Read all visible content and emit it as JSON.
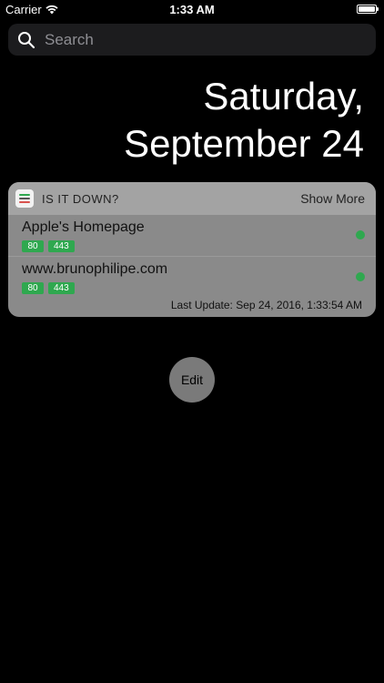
{
  "status_bar": {
    "carrier": "Carrier",
    "time": "1:33 AM",
    "battery_level": 1.0
  },
  "search": {
    "placeholder": "Search"
  },
  "date": {
    "line1": "Saturday,",
    "line2": "September 24"
  },
  "widget": {
    "title": "IS IT DOWN?",
    "show_more": "Show More",
    "sites": [
      {
        "name": "Apple's Homepage",
        "ports": [
          "80",
          "443"
        ],
        "status": "up"
      },
      {
        "name": "www.brunophilipe.com",
        "ports": [
          "80",
          "443"
        ],
        "status": "up"
      }
    ],
    "last_update": "Last Update: Sep 24, 2016, 1:33:54 AM"
  },
  "edit_label": "Edit",
  "colors": {
    "status_up": "#2fa84f",
    "widget_bg": "#8a8a8a",
    "widget_header": "#a3a3a3"
  }
}
